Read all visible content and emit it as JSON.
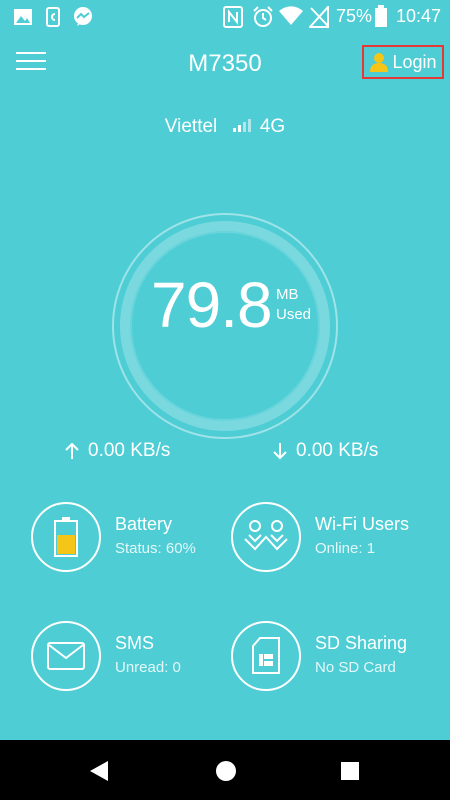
{
  "status_bar": {
    "battery_percent": "75%",
    "time": "10:47"
  },
  "header": {
    "title": "M7350",
    "login_label": "Login"
  },
  "network": {
    "carrier": "Viettel",
    "type": "4G"
  },
  "usage": {
    "value": "79.8",
    "unit": "MB",
    "label": "Used"
  },
  "speed": {
    "upload": "0.00 KB/s",
    "download": "0.00 KB/s"
  },
  "features": {
    "battery": {
      "title": "Battery",
      "status": "Status: 60%",
      "level": 0.6
    },
    "wifi_users": {
      "title": "Wi-Fi Users",
      "status": "Online: 1"
    },
    "sms": {
      "title": "SMS",
      "status": "Unread: 0"
    },
    "sd_sharing": {
      "title": "SD Sharing",
      "status": "No SD Card"
    }
  },
  "colors": {
    "background": "#4ecdd5",
    "battery_fill": "#f5c518",
    "login_icon": "#f5c518",
    "login_highlight": "#e53935",
    "nav_bar": "#000000"
  }
}
